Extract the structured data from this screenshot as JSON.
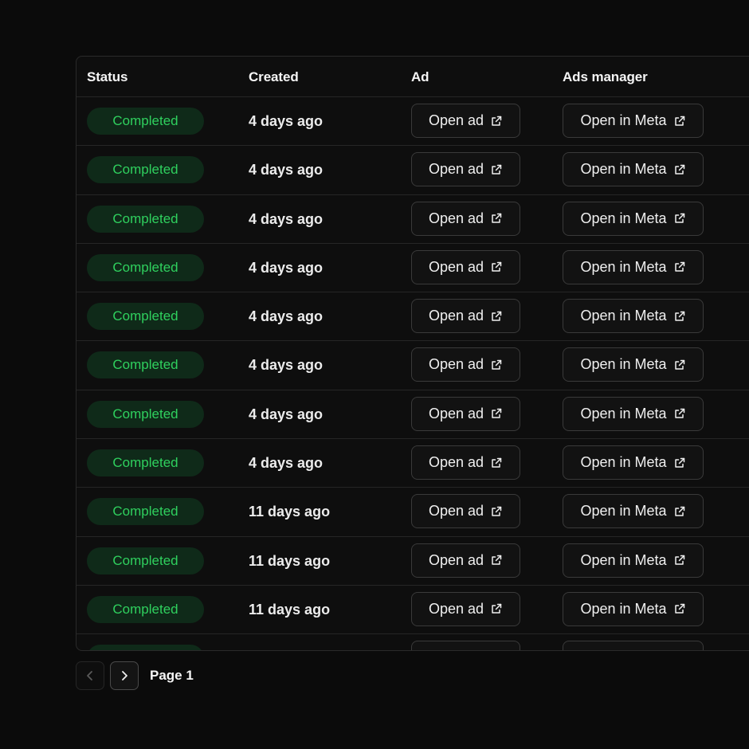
{
  "table": {
    "headers": {
      "status": "Status",
      "created": "Created",
      "ad": "Ad",
      "ads_manager": "Ads manager"
    },
    "rows": [
      {
        "status": "Completed",
        "created": "4 days ago",
        "ad_button": "Open ad",
        "meta_button": "Open in Meta"
      },
      {
        "status": "Completed",
        "created": "4 days ago",
        "ad_button": "Open ad",
        "meta_button": "Open in Meta"
      },
      {
        "status": "Completed",
        "created": "4 days ago",
        "ad_button": "Open ad",
        "meta_button": "Open in Meta"
      },
      {
        "status": "Completed",
        "created": "4 days ago",
        "ad_button": "Open ad",
        "meta_button": "Open in Meta"
      },
      {
        "status": "Completed",
        "created": "4 days ago",
        "ad_button": "Open ad",
        "meta_button": "Open in Meta"
      },
      {
        "status": "Completed",
        "created": "4 days ago",
        "ad_button": "Open ad",
        "meta_button": "Open in Meta"
      },
      {
        "status": "Completed",
        "created": "4 days ago",
        "ad_button": "Open ad",
        "meta_button": "Open in Meta"
      },
      {
        "status": "Completed",
        "created": "4 days ago",
        "ad_button": "Open ad",
        "meta_button": "Open in Meta"
      },
      {
        "status": "Completed",
        "created": "11 days ago",
        "ad_button": "Open ad",
        "meta_button": "Open in Meta"
      },
      {
        "status": "Completed",
        "created": "11 days ago",
        "ad_button": "Open ad",
        "meta_button": "Open in Meta"
      },
      {
        "status": "Completed",
        "created": "11 days ago",
        "ad_button": "Open ad",
        "meta_button": "Open in Meta"
      }
    ],
    "row_icon": "external-link-icon"
  },
  "pagination": {
    "page_label": "Page 1",
    "prev_icon": "chevron-left-icon",
    "next_icon": "chevron-right-icon"
  },
  "colors": {
    "background": "#0b0b0b",
    "status_completed_text": "#2fd05e",
    "status_completed_bg": "#0f2a19",
    "border": "#2a2a2a"
  }
}
